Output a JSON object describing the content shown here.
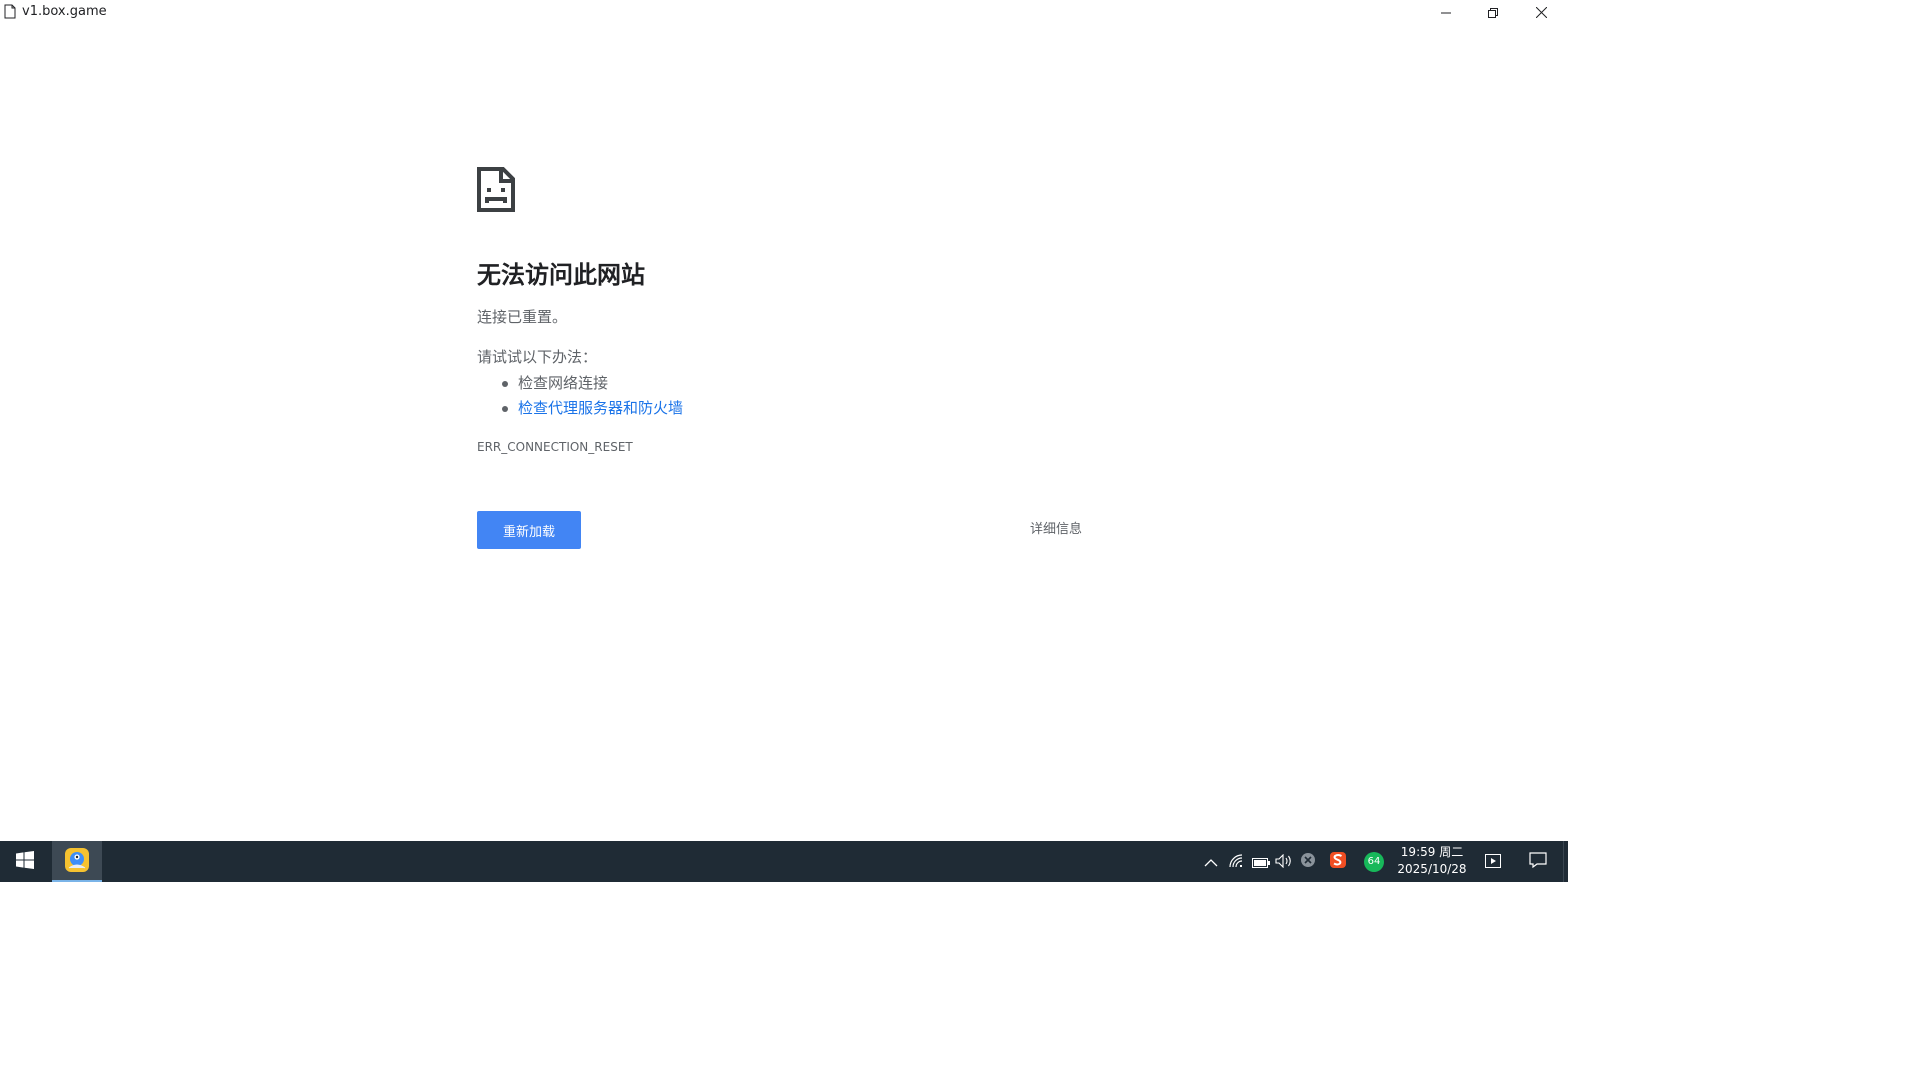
{
  "window": {
    "title": "v1.box.game",
    "minimize_icon": "minimize-icon",
    "maximize_icon": "restore-icon",
    "close_icon": "close-icon"
  },
  "error_page": {
    "icon": "sad-document-icon",
    "title": "无法访问此网站",
    "subtitle": "连接已重置。",
    "try_label": "请试试以下办法：",
    "suggestions": [
      "检查网络连接",
      "检查代理服务器和防火墙"
    ],
    "error_code": "ERR_CONNECTION_RESET",
    "reload_label": "重新加载",
    "details_label": "详细信息",
    "colors": {
      "button": "#4285f4",
      "link": "#1a73e8",
      "text": "#202124",
      "muted": "#5f6368"
    }
  },
  "taskbar": {
    "start_icon": "windows-logo-icon",
    "pinned_app_icon": "browser-app-icon",
    "tray_icons": [
      "chevron-up-icon",
      "wifi-icon",
      "battery-icon",
      "volume-icon",
      "x-circle-icon",
      "sogou-ime-icon",
      "battery-percent-badge-icon"
    ],
    "badge_text": "64",
    "clock_time": "19:59 周二",
    "clock_date": "2025/10/28",
    "media_icon": "play-icon",
    "notification_icon": "notification-icon"
  }
}
